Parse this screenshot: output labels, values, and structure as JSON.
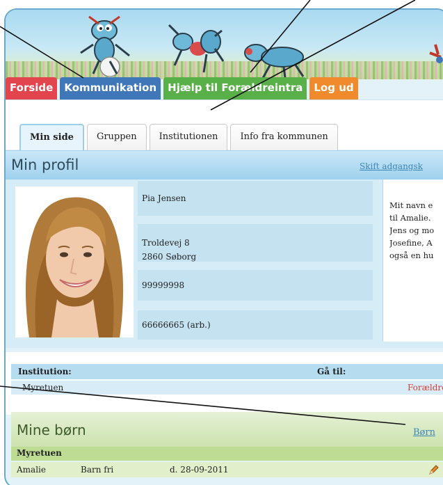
{
  "nav": {
    "items": [
      {
        "label": "Forside",
        "color": "#e2454e"
      },
      {
        "label": "Kommunikation",
        "color": "#3f77b9"
      },
      {
        "label": "Hjælp til Forældreintra",
        "color": "#5ab048"
      },
      {
        "label": "Log ud",
        "color": "#f08a2c"
      }
    ]
  },
  "tabs": [
    {
      "label": "Min side",
      "active": true
    },
    {
      "label": "Gruppen",
      "active": false
    },
    {
      "label": "Institutionen",
      "active": false
    },
    {
      "label": "Info fra kommunen",
      "active": false
    }
  ],
  "profile": {
    "title": "Min profil",
    "change_password_link": "Skift adgangsk",
    "name": "Pia Jensen",
    "address_line1": "Troldevej 8",
    "address_line2": "2860 Søborg",
    "phone": "99999998",
    "work_phone": "66666665  (arb.)",
    "description_lines": [
      "Mit navn e",
      "til Amalie.",
      "Jens og mo",
      "Josefine, A",
      "også en hu"
    ]
  },
  "institution": {
    "header_institution": "Institution:",
    "header_goto": "Gå til:",
    "name": "Myretuen",
    "goto_link": "Forældre"
  },
  "children": {
    "title": "Mine børn",
    "link": "Børn",
    "group": "Myretuen",
    "rows": [
      {
        "name": "Amalie",
        "status": "Barn fri",
        "date": "d. 28-09-2011"
      }
    ]
  }
}
